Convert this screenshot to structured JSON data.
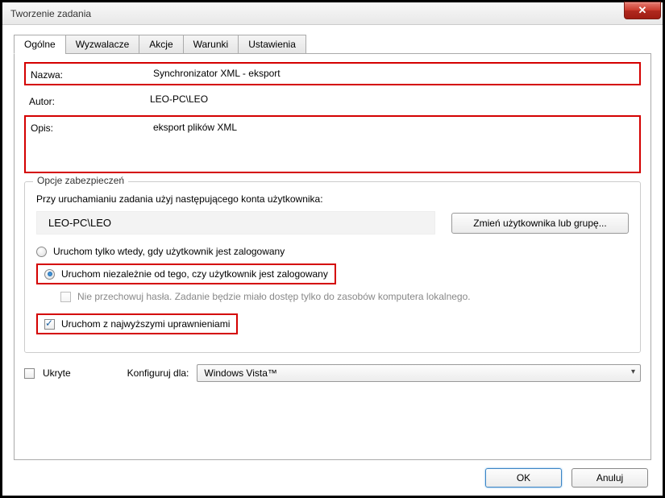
{
  "window": {
    "title": "Tworzenie zadania"
  },
  "tabs": {
    "general": "Ogólne",
    "triggers": "Wyzwalacze",
    "actions": "Akcje",
    "conditions": "Warunki",
    "settings": "Ustawienia"
  },
  "fields": {
    "name_label": "Nazwa:",
    "name_value": "Synchronizator XML - eksport",
    "author_label": "Autor:",
    "author_value": "LEO-PC\\LEO",
    "desc_label": "Opis:",
    "desc_value": "eksport plików XML"
  },
  "security": {
    "groupbox_title": "Opcje zabezpieczeń",
    "account_prompt": "Przy uruchamianiu zadania użyj następującego konta użytkownika:",
    "account_value": "LEO-PC\\LEO",
    "change_user_btn": "Zmień użytkownika lub grupę...",
    "radio_logged_on": "Uruchom tylko wtedy, gdy użytkownik jest zalogowany",
    "radio_any": "Uruchom niezależnie od tego, czy użytkownik jest zalogowany",
    "no_store_pw": "Nie przechowuj hasła. Zadanie będzie miało dostęp tylko do zasobów komputera lokalnego.",
    "highest_priv": "Uruchom z najwyższymi uprawnieniami"
  },
  "bottom": {
    "hidden_label": "Ukryte",
    "configure_for_label": "Konfiguruj dla:",
    "configure_for_value": "Windows Vista™"
  },
  "buttons": {
    "ok": "OK",
    "cancel": "Anuluj"
  }
}
